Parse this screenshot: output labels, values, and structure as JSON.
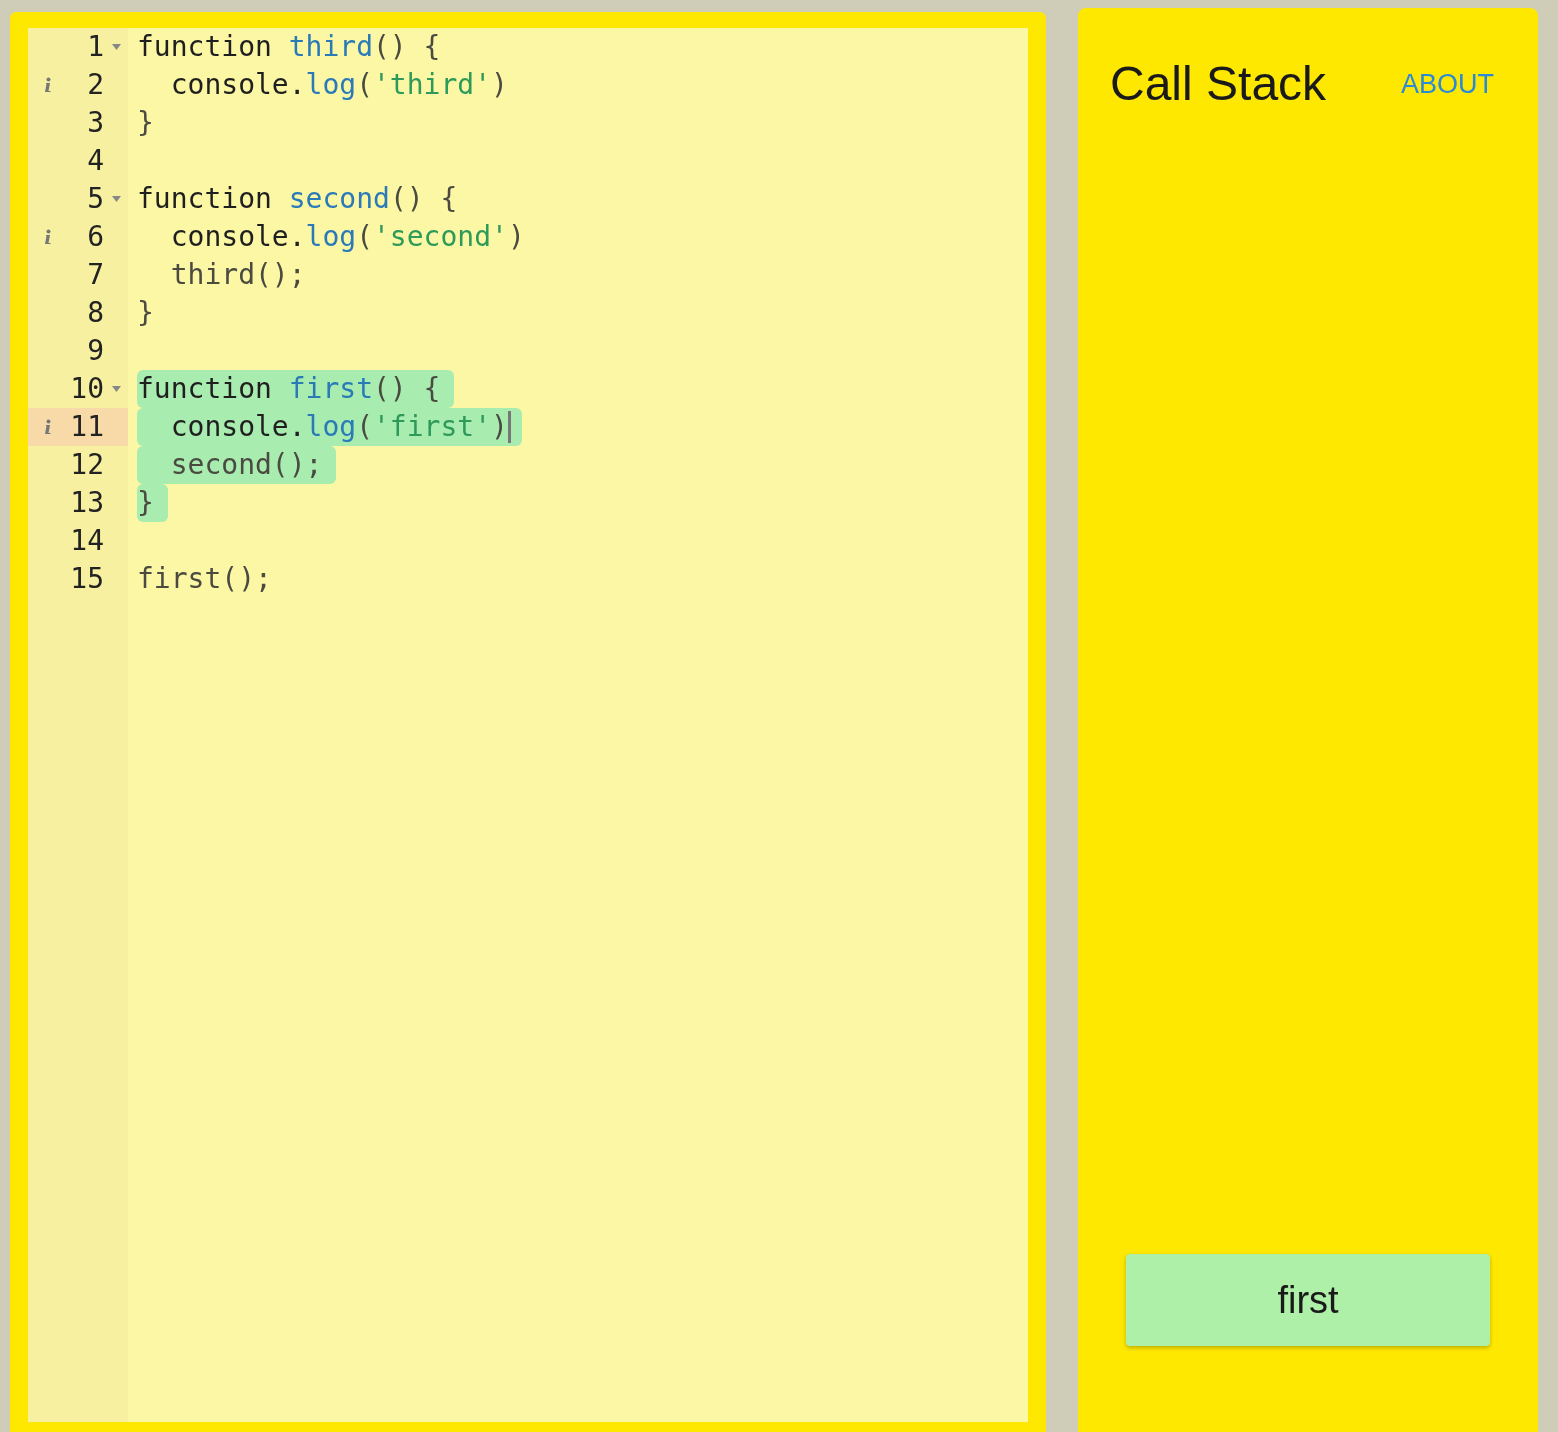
{
  "editor": {
    "lines": [
      {
        "number": "1",
        "fold": true,
        "info": false,
        "active": false,
        "highlighted": false,
        "cursor": false,
        "tokens": [
          {
            "text": "function ",
            "kind": "keyword"
          },
          {
            "text": "third",
            "kind": "def"
          },
          {
            "text": "() {",
            "kind": "plain"
          }
        ]
      },
      {
        "number": "2",
        "fold": false,
        "info": true,
        "active": false,
        "highlighted": false,
        "cursor": false,
        "tokens": [
          {
            "text": "  console.",
            "kind": "keyword"
          },
          {
            "text": "log",
            "kind": "prop"
          },
          {
            "text": "(",
            "kind": "plain"
          },
          {
            "text": "'third'",
            "kind": "string"
          },
          {
            "text": ")",
            "kind": "plain"
          }
        ]
      },
      {
        "number": "3",
        "fold": false,
        "info": false,
        "active": false,
        "highlighted": false,
        "cursor": false,
        "tokens": [
          {
            "text": "}",
            "kind": "plain"
          }
        ]
      },
      {
        "number": "4",
        "fold": false,
        "info": false,
        "active": false,
        "cursor": false
      },
      {
        "number": "5",
        "fold": true,
        "info": false,
        "active": false,
        "highlighted": false,
        "cursor": false,
        "tokens": [
          {
            "text": "function ",
            "kind": "keyword"
          },
          {
            "text": "second",
            "kind": "def"
          },
          {
            "text": "() {",
            "kind": "plain"
          }
        ]
      },
      {
        "number": "6",
        "fold": false,
        "info": true,
        "active": false,
        "highlighted": false,
        "cursor": false,
        "tokens": [
          {
            "text": "  console.",
            "kind": "keyword"
          },
          {
            "text": "log",
            "kind": "prop"
          },
          {
            "text": "(",
            "kind": "plain"
          },
          {
            "text": "'second'",
            "kind": "string"
          },
          {
            "text": ")",
            "kind": "plain"
          }
        ]
      },
      {
        "number": "7",
        "fold": false,
        "info": false,
        "active": false,
        "highlighted": false,
        "cursor": false,
        "tokens": [
          {
            "text": "  third();",
            "kind": "plain"
          }
        ]
      },
      {
        "number": "8",
        "fold": false,
        "info": false,
        "active": false,
        "highlighted": false,
        "cursor": false,
        "tokens": [
          {
            "text": "}",
            "kind": "plain"
          }
        ]
      },
      {
        "number": "9",
        "fold": false,
        "info": false,
        "active": false,
        "cursor": false
      },
      {
        "number": "10",
        "fold": true,
        "info": false,
        "active": false,
        "highlighted": true,
        "cursor": false,
        "tokens": [
          {
            "text": "function ",
            "kind": "keyword"
          },
          {
            "text": "first",
            "kind": "def"
          },
          {
            "text": "() {",
            "kind": "plain"
          }
        ]
      },
      {
        "number": "11",
        "fold": false,
        "info": true,
        "active": true,
        "highlighted": true,
        "cursor": true,
        "tokens": [
          {
            "text": "  console.",
            "kind": "keyword"
          },
          {
            "text": "log",
            "kind": "prop"
          },
          {
            "text": "(",
            "kind": "plain"
          },
          {
            "text": "'first'",
            "kind": "string"
          },
          {
            "text": ")",
            "kind": "plain"
          }
        ]
      },
      {
        "number": "12",
        "fold": false,
        "info": false,
        "active": false,
        "highlighted": true,
        "cursor": false,
        "tokens": [
          {
            "text": "  second();",
            "kind": "plain"
          }
        ]
      },
      {
        "number": "13",
        "fold": false,
        "info": false,
        "active": false,
        "highlighted": true,
        "cursor": false,
        "tokens": [
          {
            "text": "}",
            "kind": "plain"
          }
        ]
      },
      {
        "number": "14",
        "fold": false,
        "info": false,
        "active": false,
        "cursor": false
      },
      {
        "number": "15",
        "fold": false,
        "info": false,
        "active": false,
        "highlighted": false,
        "cursor": false,
        "tokens": [
          {
            "text": "first();",
            "kind": "plain"
          }
        ]
      }
    ]
  },
  "panel": {
    "title": "Call Stack",
    "link": "ABOUT",
    "frames": [
      {
        "label": "first"
      }
    ]
  }
}
